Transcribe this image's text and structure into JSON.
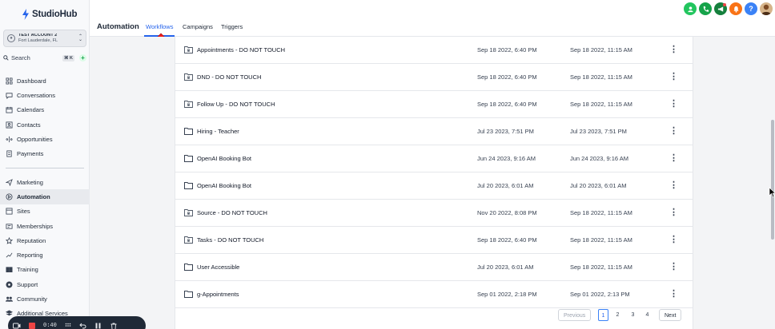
{
  "app": {
    "logo_text": "StudioHub"
  },
  "account": {
    "name": "TEST ACCOUNT 2",
    "location": "Fort Lauderdale, FL"
  },
  "search": {
    "label": "Search",
    "shortcut": "⌘ K",
    "plus": "+"
  },
  "sidebar": {
    "primary": [
      {
        "label": "Dashboard",
        "icon": "dashboard-icon"
      },
      {
        "label": "Conversations",
        "icon": "chat-icon"
      },
      {
        "label": "Calendars",
        "icon": "calendar-icon"
      },
      {
        "label": "Contacts",
        "icon": "contacts-icon"
      },
      {
        "label": "Opportunities",
        "icon": "opportunities-icon"
      },
      {
        "label": "Payments",
        "icon": "payments-icon"
      }
    ],
    "secondary": [
      {
        "label": "Marketing",
        "icon": "send-icon"
      },
      {
        "label": "Automation",
        "icon": "automation-icon",
        "active": true
      },
      {
        "label": "Sites",
        "icon": "sites-icon"
      },
      {
        "label": "Memberships",
        "icon": "memberships-icon"
      },
      {
        "label": "Reputation",
        "icon": "star-icon"
      },
      {
        "label": "Reporting",
        "icon": "reporting-icon"
      },
      {
        "label": "Training",
        "icon": "book-icon"
      },
      {
        "label": "Support",
        "icon": "support-icon"
      },
      {
        "label": "Community",
        "icon": "community-icon"
      },
      {
        "label": "Additional Services",
        "icon": "services-icon"
      }
    ]
  },
  "header": {
    "title": "Automation",
    "tabs": [
      {
        "label": "Workflows",
        "active": true
      },
      {
        "label": "Campaigns"
      },
      {
        "label": "Triggers"
      }
    ],
    "icons": [
      {
        "name": "contacts-quick-icon",
        "color": "#22c55e"
      },
      {
        "name": "phone-icon",
        "color": "#16a34a"
      },
      {
        "name": "megaphone-icon",
        "color": "#15803d"
      },
      {
        "name": "bell-icon",
        "color": "#f97316"
      },
      {
        "name": "help-icon",
        "color": "#3b82f6"
      },
      {
        "name": "user-avatar",
        "color": "#a16207"
      }
    ]
  },
  "workflows": {
    "rows": [
      {
        "name": "Appointments - DO NOT TOUCH",
        "created": "Sep 18 2022, 6:40 PM",
        "updated": "Sep 18 2022, 11:15 AM",
        "locked": true
      },
      {
        "name": "DND - DO NOT TOUCH",
        "created": "Sep 18 2022, 6:40 PM",
        "updated": "Sep 18 2022, 11:15 AM",
        "locked": true
      },
      {
        "name": "Follow Up - DO NOT TOUCH",
        "created": "Sep 18 2022, 6:40 PM",
        "updated": "Sep 18 2022, 11:15 AM",
        "locked": true
      },
      {
        "name": "Hiring - Teacher",
        "created": "Jul 23 2023, 7:51 PM",
        "updated": "Jul 23 2023, 7:51 PM",
        "locked": false
      },
      {
        "name": "OpenAI Booking Bot",
        "created": "Jun 24 2023, 9:16 AM",
        "updated": "Jun 24 2023, 9:16 AM",
        "locked": false
      },
      {
        "name": "OpenAI Booking Bot",
        "created": "Jul 20 2023, 6:01 AM",
        "updated": "Jul 20 2023, 6:01 AM",
        "locked": false
      },
      {
        "name": "Source - DO NOT TOUCH",
        "created": "Nov 20 2022, 8:08 PM",
        "updated": "Sep 18 2022, 11:15 AM",
        "locked": true
      },
      {
        "name": "Tasks - DO NOT TOUCH",
        "created": "Sep 18 2022, 6:40 PM",
        "updated": "Sep 18 2022, 11:15 AM",
        "locked": true
      },
      {
        "name": "User Accessible",
        "created": "Jul 20 2023, 6:01 AM",
        "updated": "Sep 18 2022, 11:15 AM",
        "locked": false
      },
      {
        "name": "g-Appointments",
        "created": "Sep 01 2022, 2:18 PM",
        "updated": "Sep 01 2022, 2:13 PM",
        "locked": false
      }
    ]
  },
  "pagination": {
    "previous": "Previous",
    "next": "Next",
    "pages": [
      "1",
      "2",
      "3",
      "4"
    ],
    "current": "1"
  },
  "recorder": {
    "time": "0:40"
  }
}
